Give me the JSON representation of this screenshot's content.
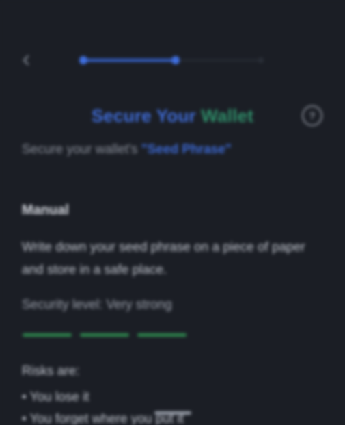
{
  "nav": {
    "progress": {
      "steps_total": 3,
      "steps_completed": 2
    }
  },
  "header": {
    "title_part1": "Secure Your ",
    "title_part2": "Wallet",
    "info_glyph": "?"
  },
  "subtitle": {
    "prefix": "Secure your wallet's ",
    "highlight": "\"Seed Phrase\""
  },
  "manual": {
    "heading": "Manual",
    "description": "Write down your seed phrase on a piece of paper and store in a safe place.",
    "security_level": "Security level: Very strong",
    "strength_segments": 3,
    "risks_heading": "Risks are:",
    "risks": [
      "You lose it",
      "You forget where you put it"
    ]
  },
  "colors": {
    "background": "#1b1e25",
    "accent_blue": "#3f6cd8",
    "accent_green": "#2f8f6a",
    "meter_green": "#2e8a4f"
  },
  "icons": {
    "back": "back-arrow-icon",
    "info": "info-icon"
  }
}
